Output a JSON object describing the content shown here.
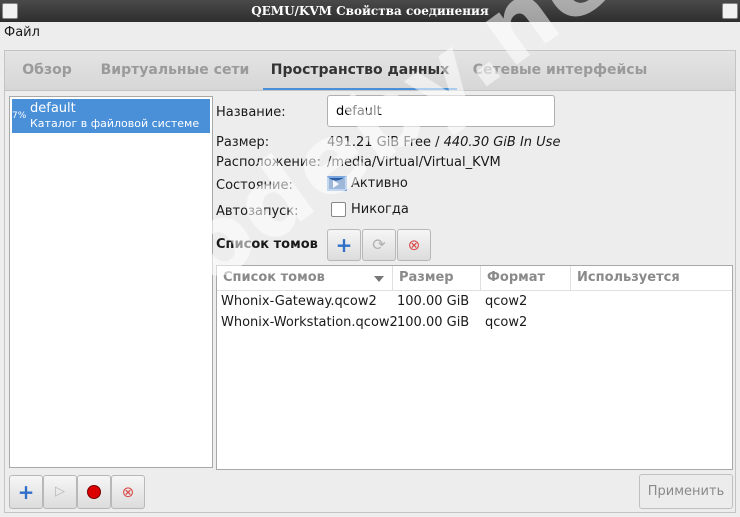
{
  "window": {
    "title": "QEMU/KVM Свойства соединения"
  },
  "menu": {
    "file": "Файл"
  },
  "tabs": [
    {
      "label": "Обзор"
    },
    {
      "label": "Виртуальные сети"
    },
    {
      "label": "Пространство данных"
    },
    {
      "label": "Сетевые интерфейсы"
    }
  ],
  "pools": [
    {
      "percent": "7%",
      "name": "default",
      "description": "Каталог в файловой системе"
    }
  ],
  "details": {
    "name_label": "Название:",
    "name_value": "default",
    "size_label": "Размер:",
    "size_free": "491.21 GiB Free /",
    "size_used": "440.30 GiB In Use",
    "location_label": "Расположение:",
    "location_value": "/media/Virtual/Virtual_KVM",
    "state_label": "Состояние:",
    "state_value": "Активно",
    "autostart_label": "Автозапуск:",
    "autostart_value": "Никогда",
    "autostart_checked": false
  },
  "volumes": {
    "title": "Список томов",
    "columns": [
      "Список томов",
      "Размер",
      "Формат",
      "Используется"
    ],
    "rows": [
      {
        "name": "Whonix-Gateway.qcow2",
        "size": "100.00 GiB",
        "format": "qcow2",
        "used": ""
      },
      {
        "name": "Whonix-Workstation.qcow2",
        "size": "100.00 GiB",
        "format": "qcow2",
        "used": ""
      }
    ]
  },
  "buttons": {
    "apply": "Применить"
  },
  "watermark": "codeby.net",
  "colors": {
    "accent": "#4a90d9",
    "selection": "#4a90d9",
    "stop": "#dd0000"
  }
}
